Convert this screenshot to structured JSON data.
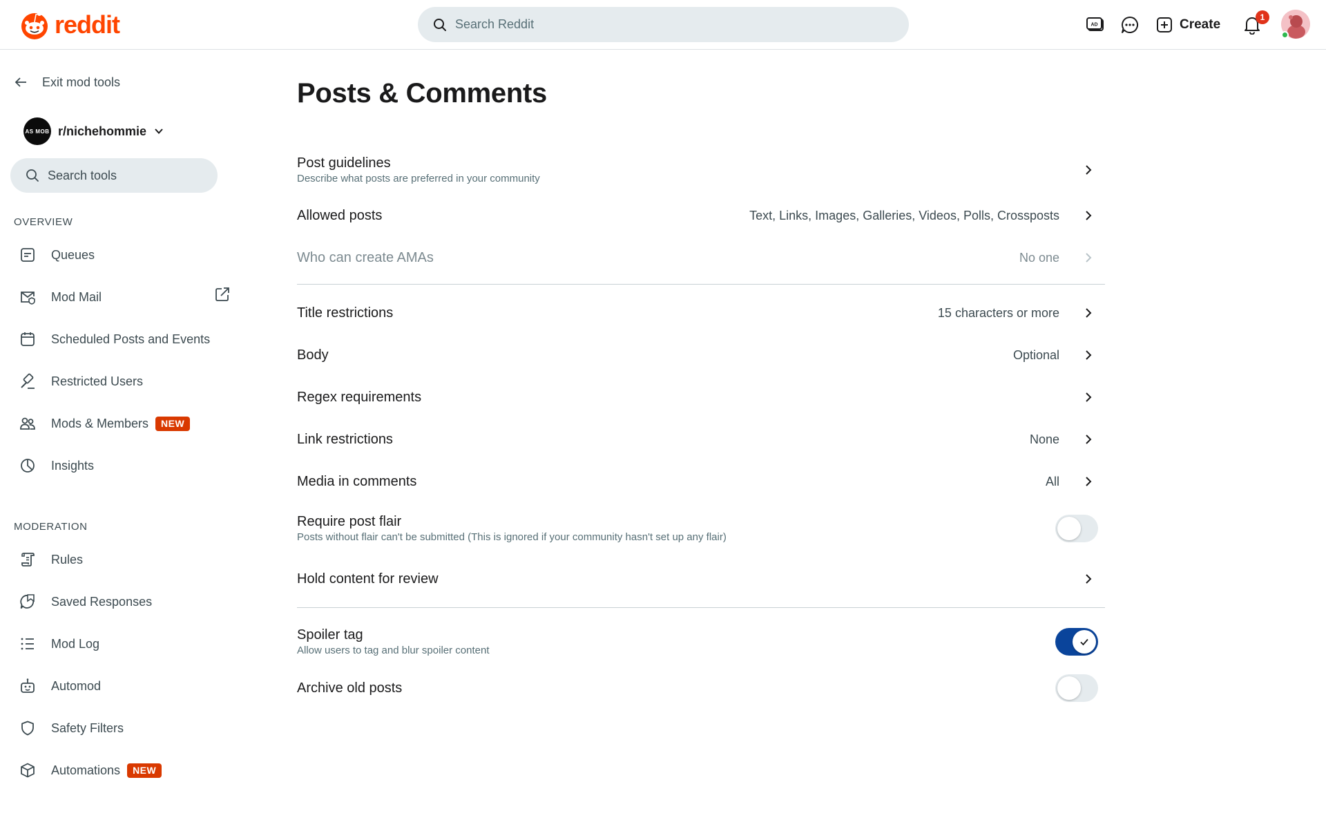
{
  "header": {
    "logo_text": "reddit",
    "search_placeholder": "Search Reddit",
    "create_label": "Create",
    "notification_count": "1",
    "brand_color": "#ff4500"
  },
  "sidebar": {
    "exit_label": "Exit mod tools",
    "community_name": "r/nichehommie",
    "community_avatar_text": "AS MOB",
    "search_placeholder": "Search tools",
    "overview_title": "OVERVIEW",
    "moderation_title": "MODERATION",
    "new_badge": "NEW",
    "overview_items": [
      {
        "label": "Queues",
        "icon": "queue-icon"
      },
      {
        "label": "Mod Mail",
        "icon": "mod-mail-icon"
      },
      {
        "label": "Scheduled Posts and Events",
        "icon": "calendar-icon"
      },
      {
        "label": "Restricted Users",
        "icon": "gavel-icon"
      },
      {
        "label": "Mods & Members",
        "icon": "members-icon"
      },
      {
        "label": "Insights",
        "icon": "pie-chart-icon"
      }
    ],
    "moderation_items": [
      {
        "label": "Rules",
        "icon": "rules-scroll-icon"
      },
      {
        "label": "Saved Responses",
        "icon": "saved-response-icon"
      },
      {
        "label": "Mod Log",
        "icon": "list-icon"
      },
      {
        "label": "Automod",
        "icon": "robot-icon"
      },
      {
        "label": "Safety Filters",
        "icon": "shield-icon"
      },
      {
        "label": "Automations",
        "icon": "cube-icon"
      }
    ]
  },
  "main": {
    "title": "Posts & Comments",
    "rows": [
      {
        "title": "Post guidelines",
        "desc": "Describe what posts are preferred in your community",
        "value": ""
      },
      {
        "title": "Allowed posts",
        "value": "Text, Links, Images, Galleries, Videos, Polls, Crossposts"
      },
      {
        "title": "Who can create AMAs",
        "value": "No one",
        "disabled": true
      },
      {
        "title": "Title restrictions",
        "value": "15 characters or more"
      },
      {
        "title": "Body",
        "value": "Optional"
      },
      {
        "title": "Regex requirements",
        "value": ""
      },
      {
        "title": "Link restrictions",
        "value": "None"
      },
      {
        "title": "Media in comments",
        "value": "All"
      },
      {
        "title": "Require post flair",
        "desc": "Posts without flair can't be submitted (This is ignored if your community hasn't set up any flair)",
        "toggle": false
      },
      {
        "title": "Hold content for review",
        "value": ""
      },
      {
        "title": "Spoiler tag",
        "desc": "Allow users to tag and blur spoiler content",
        "toggle": true
      },
      {
        "title": "Archive old posts",
        "toggle": false
      }
    ],
    "toggle_on_color": "#0a449b"
  }
}
